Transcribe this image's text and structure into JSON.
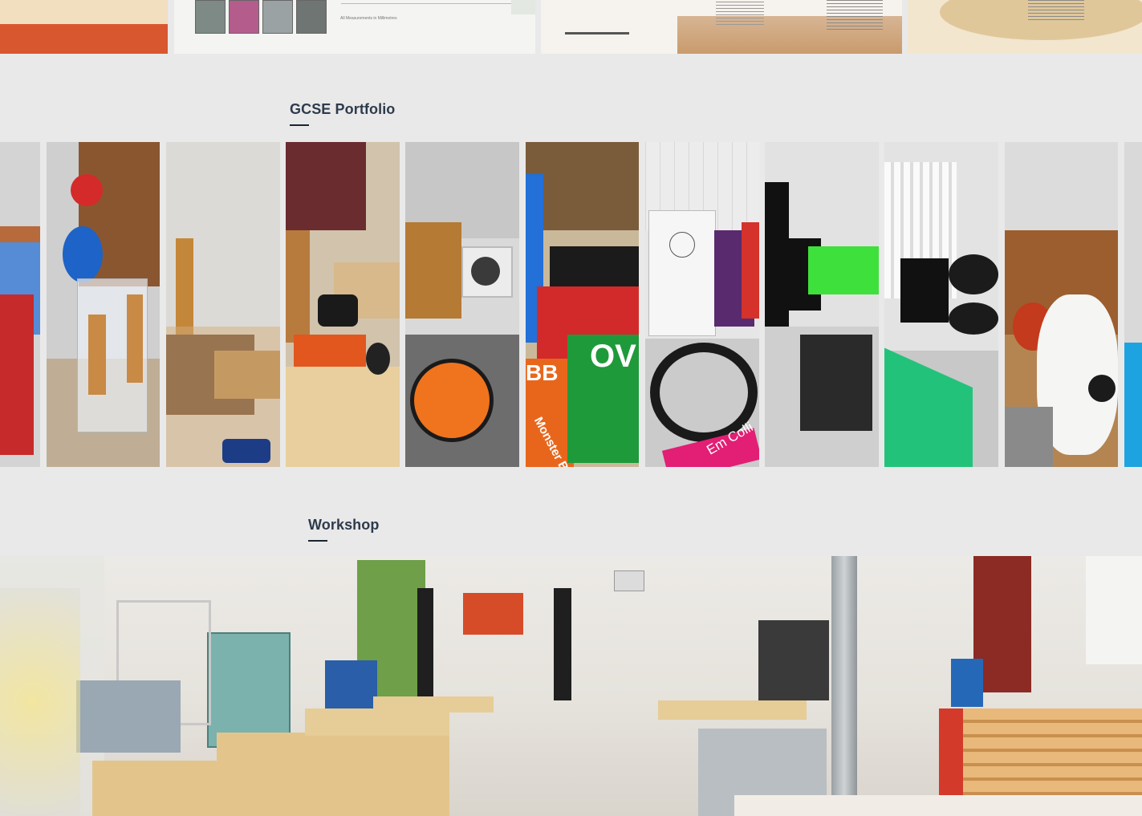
{
  "top_strip": {
    "tile_1_caption": "All Measurements in Millimetres"
  },
  "sections": {
    "gcse": {
      "title": "GCSE Portfolio"
    },
    "workshop": {
      "title": "Workshop"
    }
  },
  "gallery": {
    "tiles": [
      {
        "name": "gallery-tile-red-blue-boxes"
      },
      {
        "name": "gallery-tile-acrylic-holder"
      },
      {
        "name": "gallery-tile-wooden-box"
      },
      {
        "name": "gallery-tile-wood-pieces"
      },
      {
        "name": "gallery-tile-speaker"
      },
      {
        "name": "gallery-tile-monster-beats"
      },
      {
        "name": "gallery-tile-white-box"
      },
      {
        "name": "gallery-tile-black-pieces"
      },
      {
        "name": "gallery-tile-green-comb"
      },
      {
        "name": "gallery-tile-sheep-model"
      },
      {
        "name": "gallery-tile-cut-off"
      }
    ],
    "visible_text": {
      "monster_beats": "Monster Beats",
      "ov": "OV",
      "bb": "BB",
      "em_collins": "Em Colli"
    }
  },
  "colors": {
    "page_bg": "#e9e9e9",
    "title": "#2d3b4c",
    "accent_orange": "#d9572f"
  }
}
